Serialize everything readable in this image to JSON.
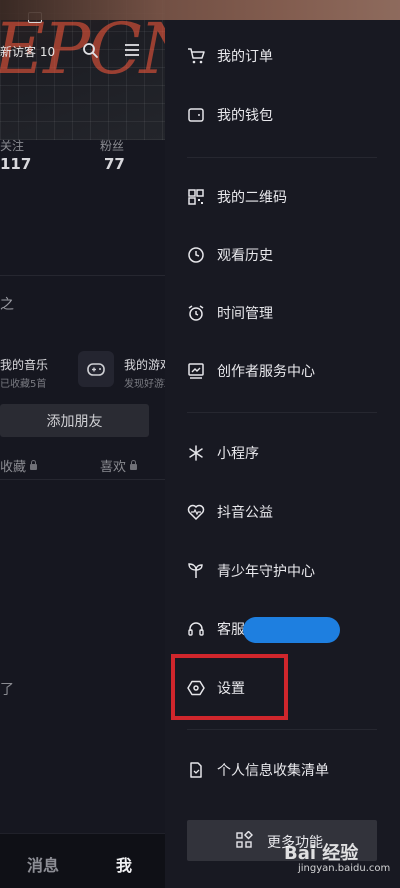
{
  "profile": {
    "visitor_text": "新访客 10",
    "stats": {
      "following_label": "关注",
      "following_value": "117",
      "fans_label": "粉丝",
      "fans_value": "77"
    },
    "partial_heading": "之",
    "music": {
      "title": "我的音乐",
      "subtitle": "已收藏5首"
    },
    "games": {
      "title": "我的游戏",
      "subtitle": "发现好游戏"
    },
    "add_friend_label": "添加朋友",
    "tabs": {
      "favorites": "收藏",
      "likes": "喜欢"
    },
    "bottom_partial": "了",
    "bottom_nav": {
      "messages": "消息",
      "me": "我"
    }
  },
  "drawer": {
    "groups": [
      [
        {
          "label": "我的订单",
          "icon": "cart-icon"
        },
        {
          "label": "我的钱包",
          "icon": "wallet-icon"
        }
      ],
      [
        {
          "label": "我的二维码",
          "icon": "qrcode-icon"
        },
        {
          "label": "观看历史",
          "icon": "history-clock-icon"
        },
        {
          "label": "时间管理",
          "icon": "alarm-clock-icon"
        },
        {
          "label": "创作者服务中心",
          "icon": "creator-chart-icon"
        }
      ],
      [
        {
          "label": "小程序",
          "icon": "asterisk-icon"
        },
        {
          "label": "抖音公益",
          "icon": "heart-wave-icon"
        },
        {
          "label": "青少年守护中心",
          "icon": "sprout-icon"
        },
        {
          "label": "客服",
          "icon": "headset-icon"
        },
        {
          "label": "设置",
          "icon": "settings-hexagon-icon"
        }
      ],
      [
        {
          "label": "个人信息收集清单",
          "icon": "document-icon"
        }
      ]
    ],
    "more_button_label": "更多功能"
  },
  "watermark": {
    "brand": "Bai 经验",
    "url": "jingyan.baidu.com"
  },
  "colors": {
    "highlight_box": "#d0262c",
    "redaction_blue": "#1e7fe0",
    "drawer_bg": "#181922"
  }
}
